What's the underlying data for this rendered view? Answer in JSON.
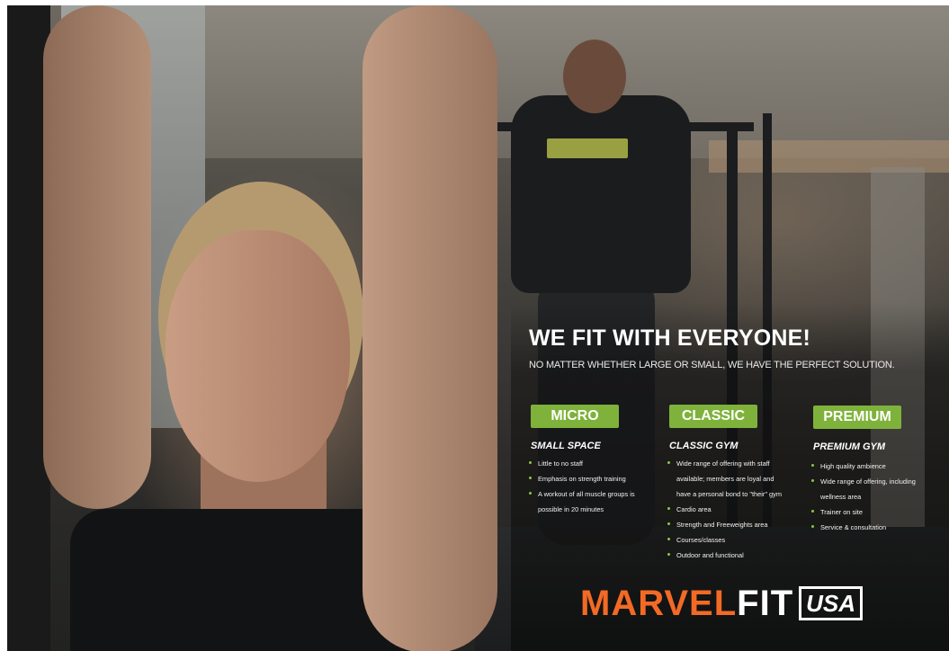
{
  "headline": "WE FIT WITH EVERYONE!",
  "subheadline": "NO MATTER WHETHER LARGE OR SMALL, WE HAVE THE PERFECT SOLUTION.",
  "colors": {
    "accent_green": "#7fb23b",
    "brand_orange": "#f26a25",
    "brand_white": "#ffffff",
    "bullet_green": "#8dc63f"
  },
  "columns": [
    {
      "badge": "MICRO",
      "title": "SMALL SPACE",
      "items": [
        "Little to no staff",
        "Emphasis on strength training",
        "A workout of all muscle groups  is",
        "possible in 20 minutes"
      ]
    },
    {
      "badge": "CLASSIC",
      "title": "CLASSIC GYM",
      "items": [
        "Wide range of offering with  staff",
        "available; members are  loyal and",
        "have a personal  bond to \"their\" gym",
        "Cardio area",
        "Strength and Freeweights area",
        "Courses/classes",
        "Outdoor and functional"
      ]
    },
    {
      "badge": "PREMIUM",
      "title": "PREMIUM GYM",
      "items": [
        "High quality ambience",
        "Wide range of offering, including",
        "wellness area",
        "Trainer on site",
        "Service & consultation"
      ]
    }
  ],
  "brand": {
    "marvel": "MARVEL",
    "fit": "FIT",
    "usa": "USA"
  }
}
